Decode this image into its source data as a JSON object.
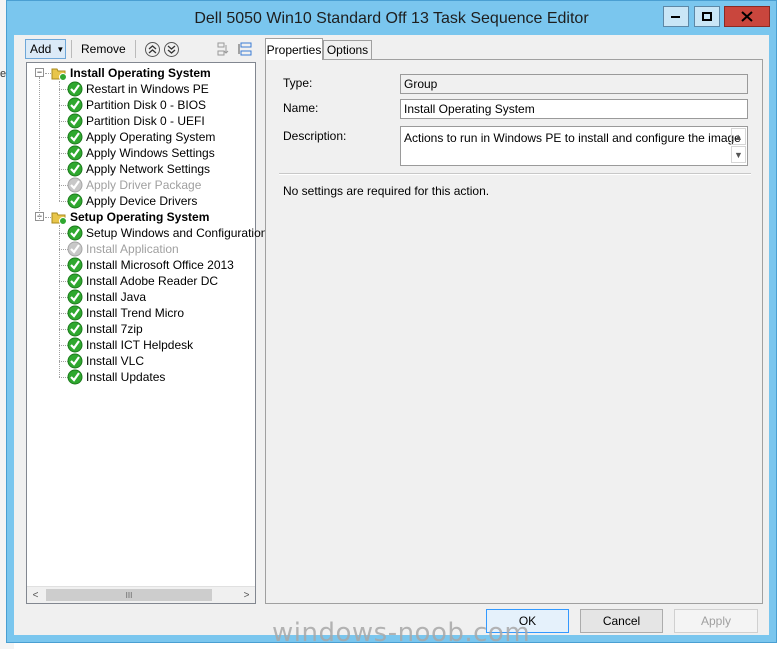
{
  "background": {
    "partial_text": "es"
  },
  "window": {
    "title": "Dell 5050 Win10 Standard Off 13 Task Sequence Editor",
    "controls": {
      "minimize_icon": "minimize-icon",
      "maximize_icon": "maximize-icon",
      "close_icon": "close-icon"
    }
  },
  "toolbar": {
    "add_label": "Add",
    "remove_label": "Remove"
  },
  "tree": {
    "groups": [
      {
        "label": "Install Operating System",
        "items": [
          {
            "label": "Restart in Windows PE",
            "enabled": true
          },
          {
            "label": "Partition Disk 0 - BIOS",
            "enabled": true
          },
          {
            "label": "Partition Disk 0 - UEFI",
            "enabled": true
          },
          {
            "label": "Apply Operating System",
            "enabled": true
          },
          {
            "label": "Apply Windows Settings",
            "enabled": true
          },
          {
            "label": "Apply Network Settings",
            "enabled": true
          },
          {
            "label": "Apply Driver Package",
            "enabled": false
          },
          {
            "label": "Apply Device Drivers",
            "enabled": true
          }
        ]
      },
      {
        "label": "Setup Operating System",
        "items": [
          {
            "label": "Setup Windows and Configuration",
            "enabled": true
          },
          {
            "label": "Install Application",
            "enabled": false
          },
          {
            "label": "Install Microsoft Office 2013",
            "enabled": true
          },
          {
            "label": "Install Adobe Reader DC",
            "enabled": true
          },
          {
            "label": "Install Java",
            "enabled": true
          },
          {
            "label": "Install Trend Micro",
            "enabled": true
          },
          {
            "label": "Install 7zip",
            "enabled": true
          },
          {
            "label": "Install ICT Helpdesk",
            "enabled": true
          },
          {
            "label": "Install VLC",
            "enabled": true
          },
          {
            "label": "Install Updates",
            "enabled": true
          }
        ]
      }
    ],
    "scroll_thumb_glyph": "III"
  },
  "tabs": [
    {
      "label": "Properties",
      "active": true
    },
    {
      "label": "Options",
      "active": false
    }
  ],
  "properties": {
    "type_label": "Type:",
    "type_value": "Group",
    "name_label": "Name:",
    "name_value": "Install Operating System",
    "description_label": "Description:",
    "description_value": "Actions to run in Windows PE to install and configure the image",
    "message": "No settings are required  for this action."
  },
  "buttons": {
    "ok": "OK",
    "cancel": "Cancel",
    "apply": "Apply"
  },
  "watermark": "windows-noob.com",
  "colors": {
    "title_bar": "#7ac6ee",
    "close_button": "#c9463d",
    "check_green": "#2fa82f",
    "disabled_gray": "#a0a0a0",
    "group_folder": "#e8c54a"
  }
}
